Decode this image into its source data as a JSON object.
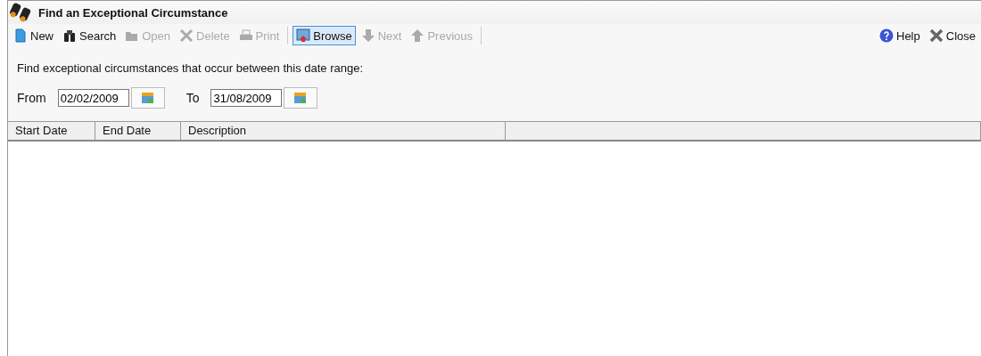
{
  "window": {
    "title": "Find an Exceptional Circumstance"
  },
  "toolbar": [
    {
      "kind": "new",
      "label": "New",
      "disabled": false,
      "selected": false
    },
    {
      "kind": "search",
      "label": "Search",
      "disabled": false,
      "selected": false
    },
    {
      "kind": "open",
      "label": "Open",
      "disabled": true,
      "selected": false
    },
    {
      "kind": "delete",
      "label": "Delete",
      "disabled": true,
      "selected": false
    },
    {
      "kind": "print",
      "label": "Print",
      "disabled": true,
      "selected": false
    },
    {
      "kind": "browse",
      "label": "Browse",
      "disabled": false,
      "selected": true
    },
    {
      "kind": "next",
      "label": "Next",
      "disabled": true,
      "selected": false
    },
    {
      "kind": "previous",
      "label": "Previous",
      "disabled": true,
      "selected": false
    }
  ],
  "toolbar_right": [
    {
      "kind": "help",
      "label": "Help",
      "disabled": false,
      "selected": false
    },
    {
      "kind": "close",
      "label": "Close",
      "disabled": false,
      "selected": false
    }
  ],
  "prompt": "Find exceptional circumstances that occur between this date range:",
  "date_fields": [
    {
      "label": "From",
      "value": "02/02/2009"
    },
    {
      "label": "To",
      "value": "31/08/2009"
    }
  ],
  "table": {
    "columns": [
      "Start Date",
      "End Date",
      "Description"
    ]
  }
}
